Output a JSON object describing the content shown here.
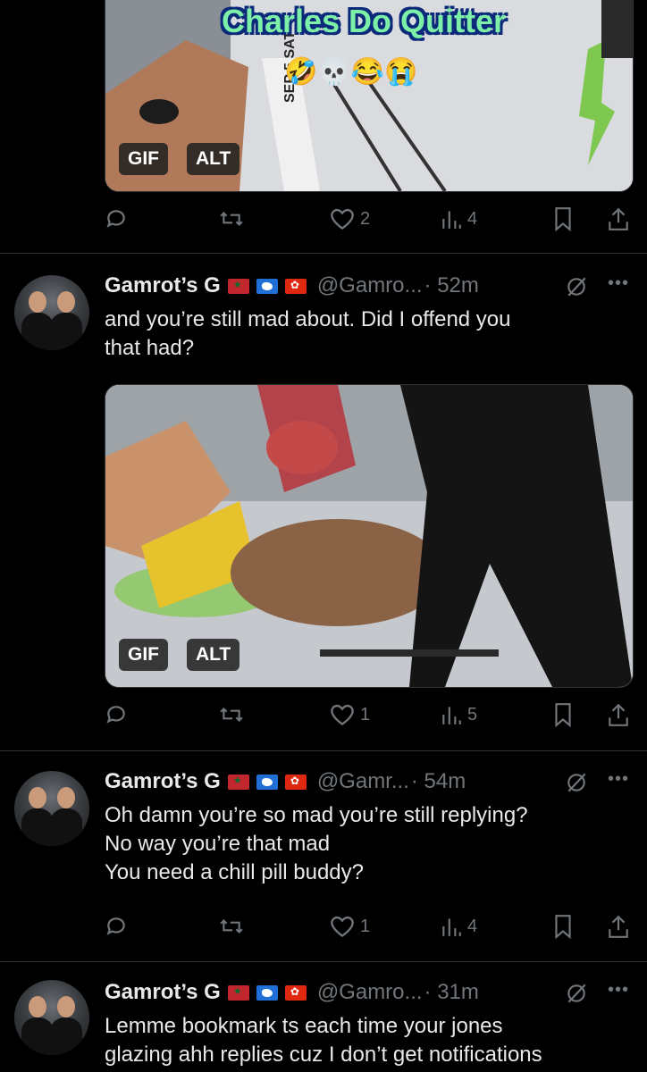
{
  "tweets": [
    {
      "media": {
        "caption": "Charles Do Quitter",
        "emojis": "🤣💀😂😭",
        "gif_label": "GIF",
        "alt_label": "ALT",
        "banner_text_1": "SEP 5 SAT"
      },
      "actions": {
        "likes": "2",
        "views": "4"
      }
    },
    {
      "author": {
        "name": "Gamrot’s G",
        "handle": "@Gamro...",
        "time": "· 52m"
      },
      "text": "and you’re still mad about. Did I offend you\nthat had?",
      "media": {
        "gif_label": "GIF",
        "alt_label": "ALT"
      },
      "actions": {
        "likes": "1",
        "views": "5"
      }
    },
    {
      "author": {
        "name": "Gamrot’s G",
        "handle": "@Gamr...",
        "time": "· 54m"
      },
      "text": "Oh damn you’re so mad you’re still replying?\nNo way you’re that mad\nYou need a chill pill buddy?",
      "actions": {
        "likes": "1",
        "views": "4"
      }
    },
    {
      "author": {
        "name": "Gamrot’s G",
        "handle": "@Gamro...",
        "time": "· 31m"
      },
      "text": "Lemme bookmark ts each time your jones\nglazing ahh replies cuz I don’t get notifications"
    }
  ],
  "icons": [
    "reply-icon",
    "retweet-icon",
    "like-icon",
    "views-icon",
    "bookmark-icon",
    "share-icon",
    "grok-icon",
    "more-icon"
  ],
  "colors": {
    "background": "#000000",
    "text": "#e7e9ea",
    "muted": "#71767b",
    "separator": "#2f3336"
  }
}
